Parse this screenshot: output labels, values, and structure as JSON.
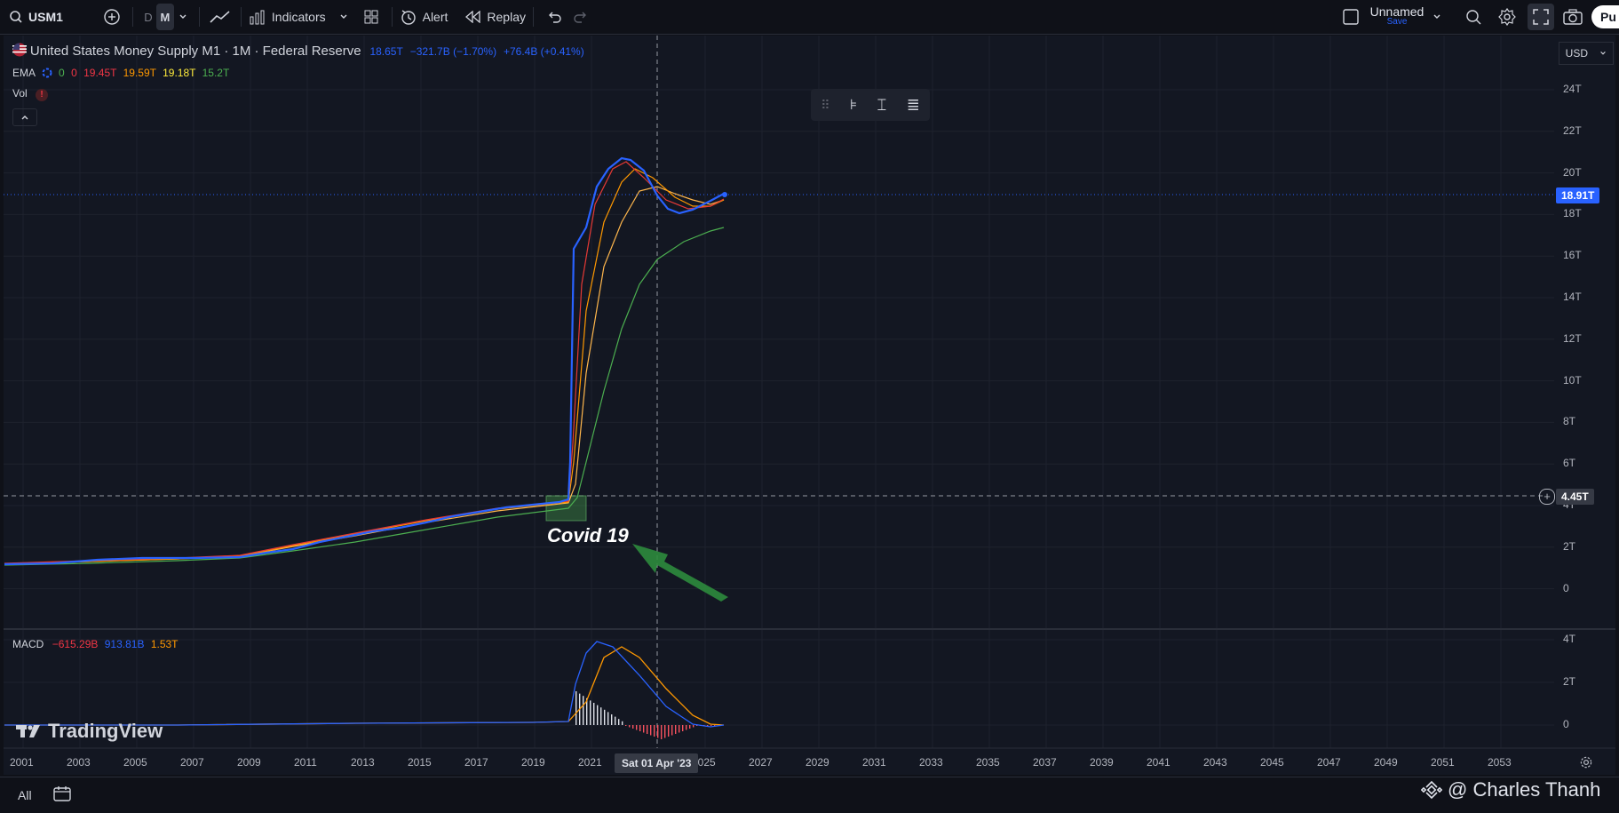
{
  "toolbar": {
    "symbol": "USM1",
    "interval_d": "D",
    "interval_m": "M",
    "indicators_label": "Indicators",
    "alert_label": "Alert",
    "replay_label": "Replay",
    "layout_name": "Unnamed",
    "layout_status": "Save",
    "publish_label": "Pu"
  },
  "legend": {
    "title": "United States Money Supply M1 · 1M · Federal Reserve",
    "last": "18.65T",
    "change": "−321.7B (−1.70%)",
    "change2": "+76.4B (+0.41%)",
    "ema_label": "EMA",
    "ema_vals": [
      "0",
      "0",
      "19.45T",
      "19.59T",
      "19.18T",
      "15.2T"
    ],
    "vol_label": "Vol",
    "macd_label": "MACD",
    "macd_vals": [
      "−615.29B",
      "913.81B",
      "1.53T"
    ]
  },
  "currency": "USD",
  "price_axis": [
    "24T",
    "22T",
    "20T",
    "18T",
    "16T",
    "14T",
    "12T",
    "10T",
    "8T",
    "6T",
    "4T",
    "2T",
    "0"
  ],
  "macd_axis": [
    "4T",
    "2T",
    "0"
  ],
  "price_tag": "18.91T",
  "crosshair_price": "4.45T",
  "crosshair_date": "Sat 01 Apr '23",
  "time_axis": [
    "2001",
    "2003",
    "2005",
    "2007",
    "2009",
    "2011",
    "2013",
    "2015",
    "2017",
    "2019",
    "2021",
    "2025",
    "2027",
    "2029",
    "2031",
    "2033",
    "2035",
    "2037",
    "2039",
    "2041",
    "2043",
    "2045",
    "2047",
    "2049",
    "2051",
    "2053"
  ],
  "annotation": "Covid 19",
  "brand": "TradingView",
  "watermark": "@ Charles Thanh",
  "bottom": {
    "all_label": "All"
  },
  "colors": {
    "price": "#2962ff",
    "ema_red": "#f23645",
    "ema_orange": "#ff9800",
    "ema_yellow": "#ffeb3b",
    "ema_green": "#4caf50",
    "arrow": "#2e8b3d"
  },
  "chart_data": {
    "type": "line",
    "title": "United States Money Supply M1 · 1M · Federal Reserve",
    "x": [
      2001,
      2005,
      2009,
      2012,
      2015,
      2018,
      2020.2,
      2020.4,
      2021,
      2022,
      2023,
      2024,
      2025.5
    ],
    "series": [
      {
        "name": "USM1",
        "values": [
          1.1,
          1.3,
          1.4,
          2.2,
          2.9,
          3.6,
          4.0,
          16.2,
          18.8,
          20.6,
          18.9,
          18.1,
          18.9
        ]
      }
    ],
    "ylim": [
      0,
      24
    ],
    "grid": true
  }
}
